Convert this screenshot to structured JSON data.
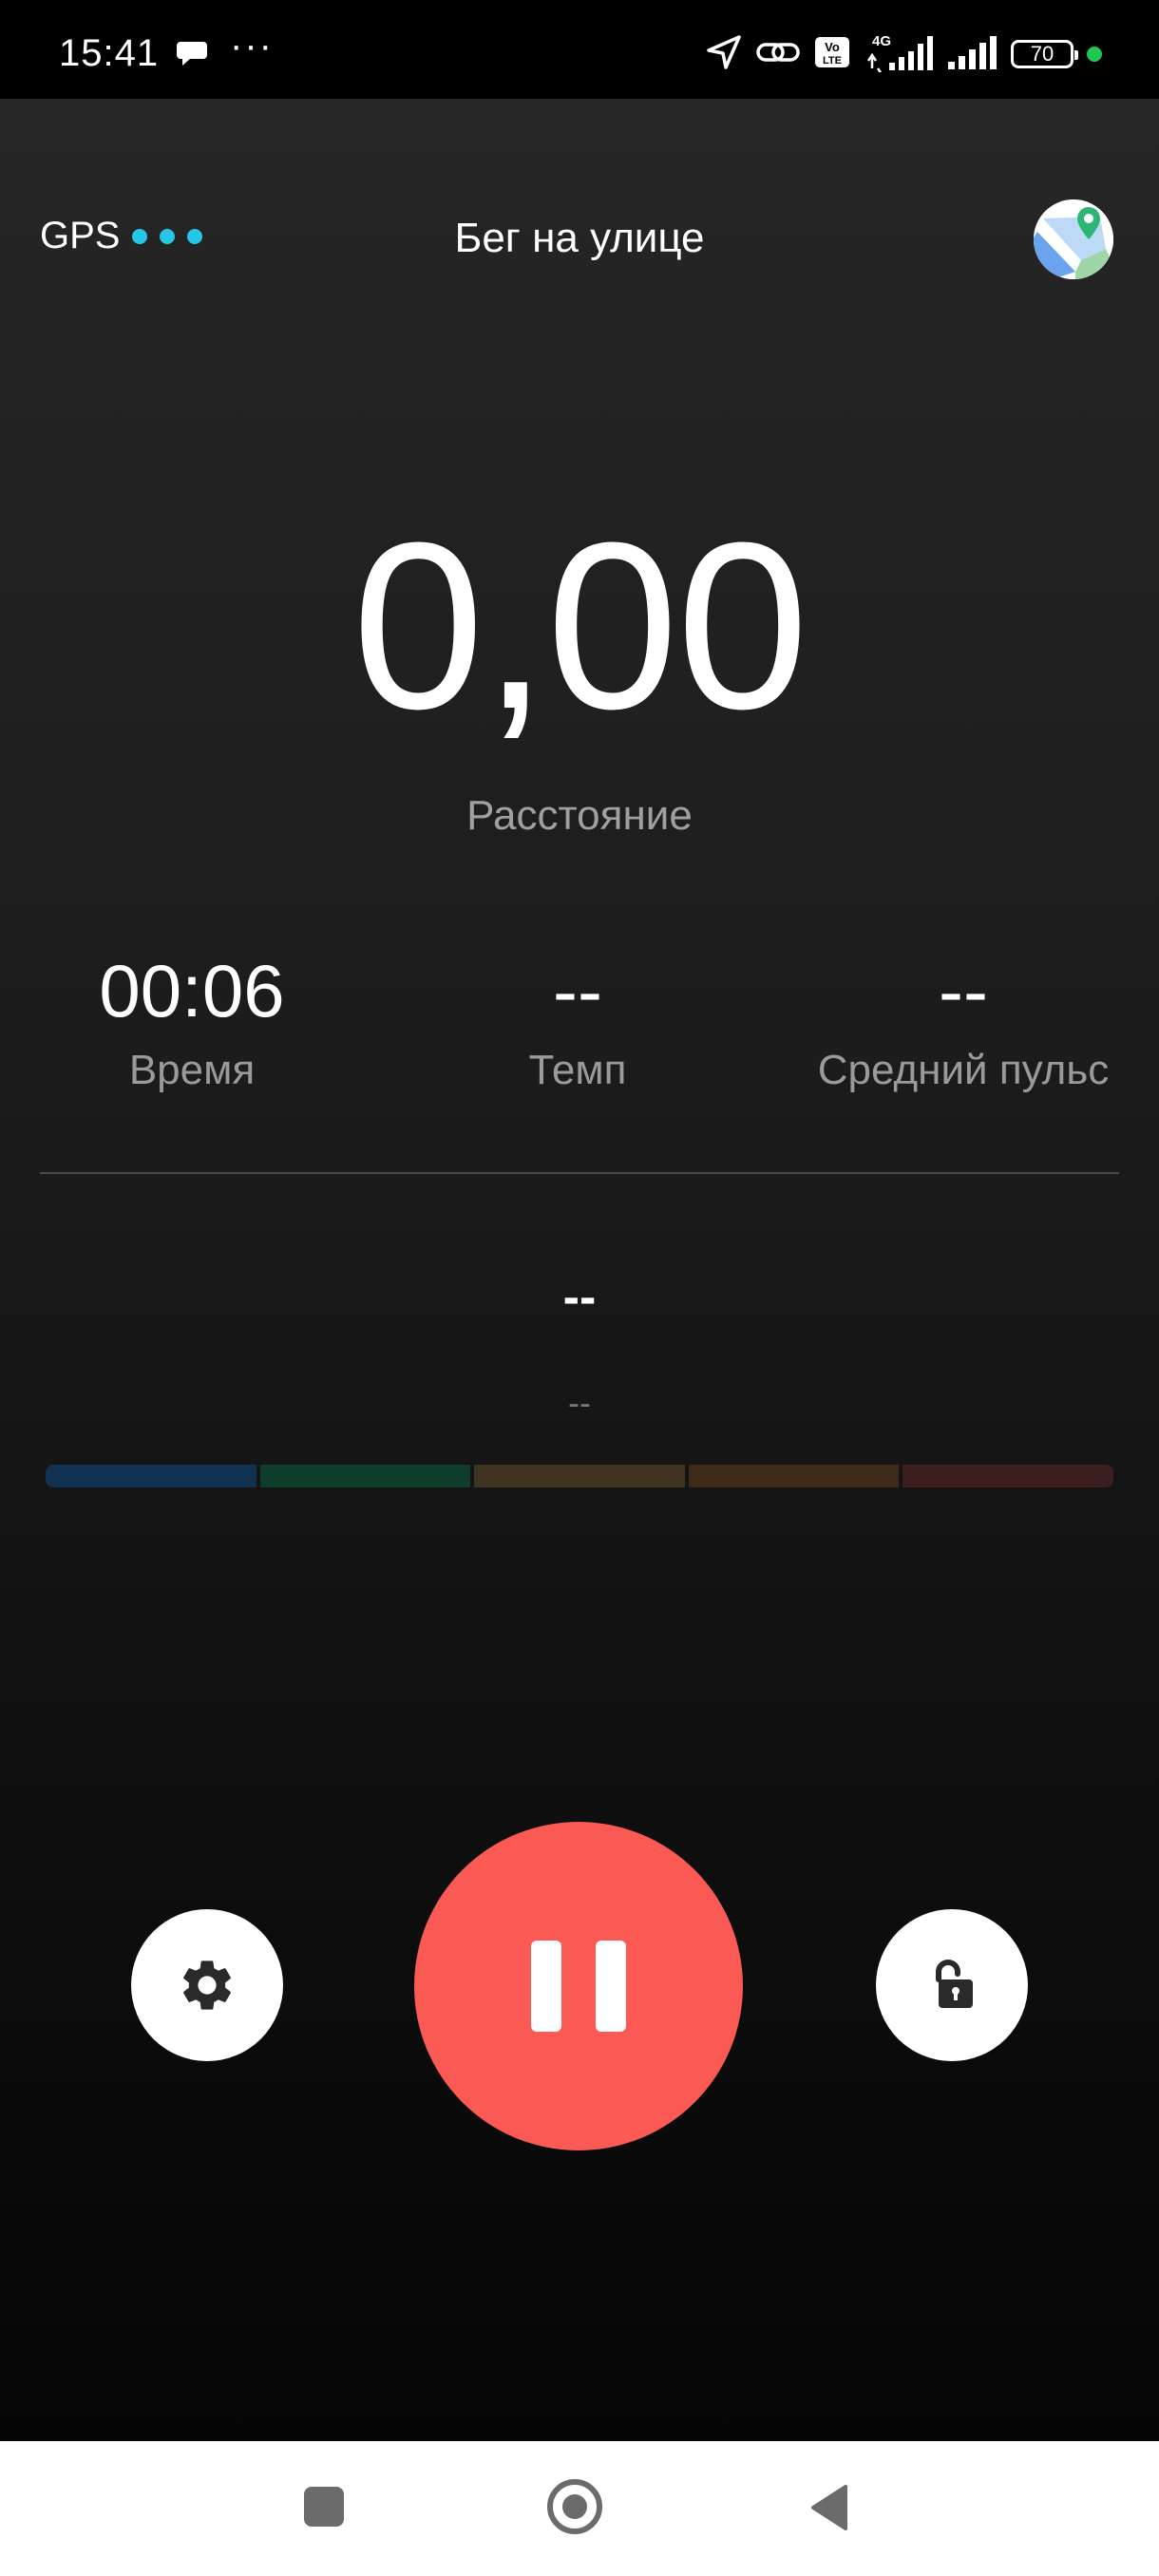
{
  "status_bar": {
    "time": "15:41",
    "more": "···",
    "battery": "70",
    "icons": [
      "chat-bubble-icon",
      "location-arrow-icon",
      "link-icon",
      "volte-icon",
      "signal-4g-icon",
      "signal-icon",
      "battery-icon",
      "dot-indicator"
    ]
  },
  "header": {
    "gps_label": "GPS",
    "title": "Бег на улице"
  },
  "distance": {
    "value": "0,00",
    "label": "Расстояние"
  },
  "metrics": [
    {
      "value": "00:06",
      "label": "Время"
    },
    {
      "value": "--",
      "label": "Темп"
    },
    {
      "value": "--",
      "label": "Средний пульс"
    }
  ],
  "heart_rate": {
    "value": "--",
    "zone": "--"
  },
  "zone_colors": [
    "#10314f",
    "#0f3d2c",
    "#3f3322",
    "#3d2a18",
    "#3d1e1e"
  ],
  "colors": {
    "accent": "#fa5a53",
    "gps_dots": "#27c6e6"
  }
}
